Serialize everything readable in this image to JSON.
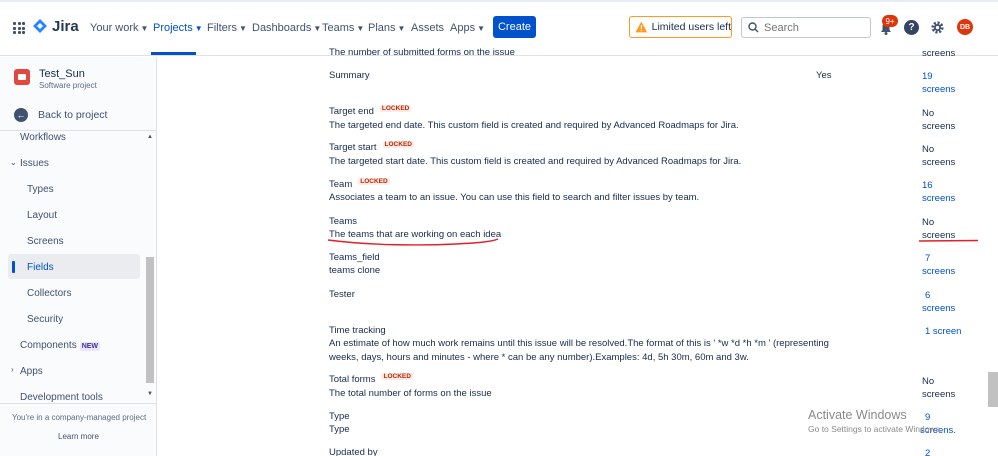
{
  "nav": {
    "logo": "Jira",
    "items": [
      {
        "label": "Your work"
      },
      {
        "label": "Projects"
      },
      {
        "label": "Filters"
      },
      {
        "label": "Dashboards"
      },
      {
        "label": "Teams"
      },
      {
        "label": "Plans"
      },
      {
        "label": "Assets"
      },
      {
        "label": "Apps"
      }
    ],
    "create": "Create",
    "limited_users": "Limited users left",
    "search_placeholder": "Search",
    "notifications_badge": "9+",
    "help": "?",
    "avatar_initials": "DB"
  },
  "sidebar": {
    "project_name": "Test_Sun",
    "project_type": "Software project",
    "back": "Back to project",
    "items": [
      {
        "label": "Workflows"
      },
      {
        "label": "Issues"
      },
      {
        "label": "Types"
      },
      {
        "label": "Layout"
      },
      {
        "label": "Screens"
      },
      {
        "label": "Fields"
      },
      {
        "label": "Collectors"
      },
      {
        "label": "Security"
      },
      {
        "label": "Components"
      },
      {
        "label": "Apps"
      },
      {
        "label": "Development tools"
      }
    ],
    "new_badge": "NEW",
    "company_text": "You're in a company-managed project",
    "learn_more": "Learn more"
  },
  "locked_label": "LOCKED",
  "fields": [
    {
      "name": "",
      "description": "The number of submitted forms on the issue",
      "required": "",
      "screens_line1": "",
      "screens_line2": "screens"
    },
    {
      "name": "Summary",
      "description": "",
      "required": "Yes",
      "screens_line1": "19",
      "screens_line2": "screens"
    },
    {
      "name": "Target end",
      "description": "The targeted end date. This custom field is created and required by Advanced Roadmaps for Jira.",
      "required": "",
      "screens_line1": "No",
      "screens_line2": "screens"
    },
    {
      "name": "Target start",
      "description": "The targeted start date. This custom field is created and required by Advanced Roadmaps for Jira.",
      "required": "",
      "screens_line1": "No",
      "screens_line2": "screens"
    },
    {
      "name": "Team",
      "description": "Associates a team to an issue. You can use this field to search and filter issues by team.",
      "required": "",
      "screens_line1": "16",
      "screens_line2": "screens"
    },
    {
      "name": "Teams",
      "description": "The teams that are working on each idea",
      "required": "",
      "screens_line1": "No",
      "screens_line2": "screens"
    },
    {
      "name": "Teams_field",
      "description": "teams clone",
      "required": "",
      "screens_line1": "7",
      "screens_line2": "screens"
    },
    {
      "name": "Tester",
      "description": "",
      "required": "",
      "screens_line1": "6",
      "screens_line2": "screens"
    },
    {
      "name": "Time tracking",
      "description": "An estimate of how much work remains until this issue will be resolved.The format of this is ' *w *d *h *m ' (representing",
      "description2": "weeks, days, hours and minutes - where * can be any number).Examples: 4d, 5h 30m, 60m and 3w.",
      "required": "",
      "screens_line1": "1 screen",
      "screens_line2": ""
    },
    {
      "name": "Total forms",
      "description": "The total number of forms on the issue",
      "required": "",
      "screens_line1": "No",
      "screens_line2": "screens"
    },
    {
      "name": "Type",
      "description": "Type",
      "required": "",
      "screens_line1": "9",
      "screens_line2": "screens."
    },
    {
      "name": "Updated by",
      "description": "",
      "required": "",
      "screens_line1": "2",
      "screens_line2": ""
    }
  ],
  "watermark": {
    "title": "Activate Windows",
    "subtitle": "Go to Settings to activate Windows."
  },
  "colors": {
    "brand": "#0052cc",
    "locked": "#bf2600",
    "annotation": "#e0202a",
    "warning": "#ff991f"
  }
}
